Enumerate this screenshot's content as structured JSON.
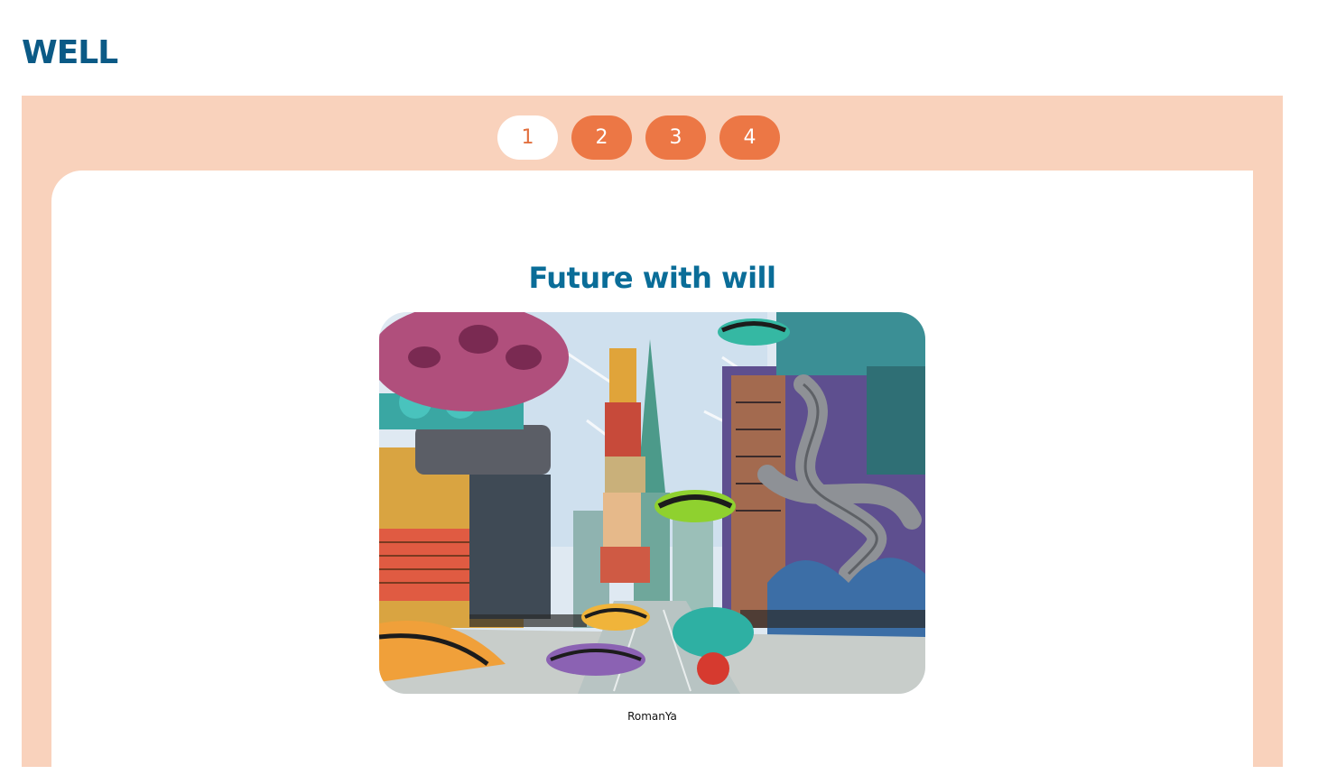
{
  "header": {
    "title": "WELL"
  },
  "pager": {
    "pages": [
      "1",
      "2",
      "3",
      "4"
    ],
    "active_index": 0
  },
  "slide": {
    "title": "Future with will",
    "image_description": "comic-style futuristic city street with flying cars",
    "credit": "RomanYa"
  },
  "colors": {
    "heading": "#0b5a86",
    "panel_bg": "#f9d2bc",
    "button_bg": "#ec7745",
    "active_button_bg": "#ffffff",
    "slide_title": "#0a6d98"
  }
}
